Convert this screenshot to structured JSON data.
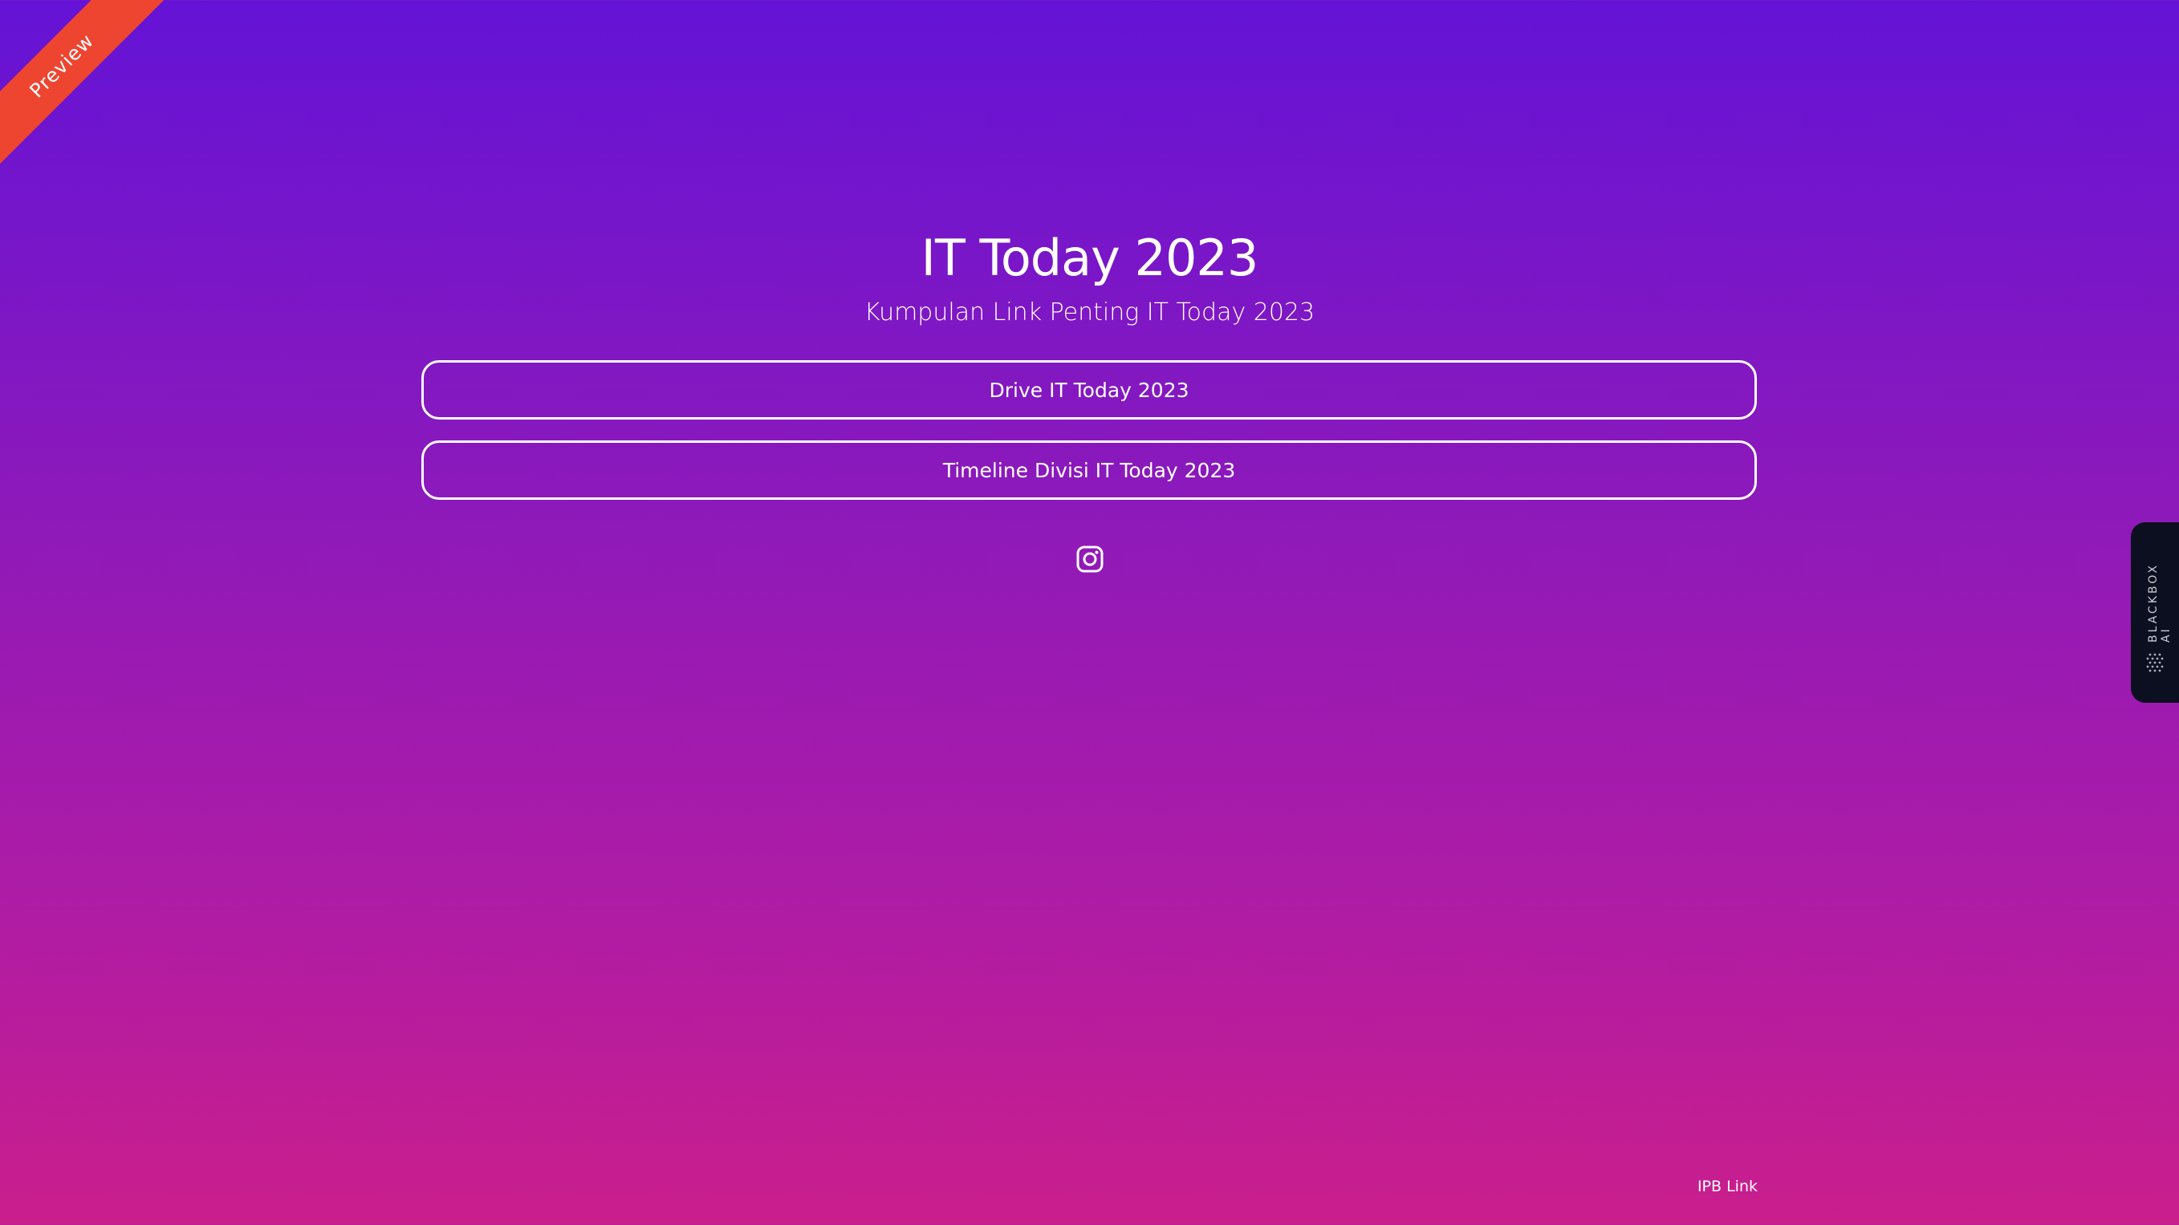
{
  "ribbon": {
    "label": "Preview",
    "color": "#ee4531"
  },
  "header": {
    "title": "IT Today 2023",
    "subtitle": "Kumpulan Link Penting IT Today 2023"
  },
  "links": [
    {
      "label": "Drive IT Today 2023"
    },
    {
      "label": "Timeline Divisi IT Today 2023"
    }
  ],
  "social": {
    "icon": "instagram-icon"
  },
  "footer": {
    "link_label": "IPB Link"
  },
  "side_tab": {
    "label": "BLACKBOX AI",
    "icon": "blackbox-dots-icon"
  },
  "colors": {
    "gradient_top": "#6413d6",
    "gradient_bottom": "#ca1e8c",
    "text": "#ffffff"
  }
}
